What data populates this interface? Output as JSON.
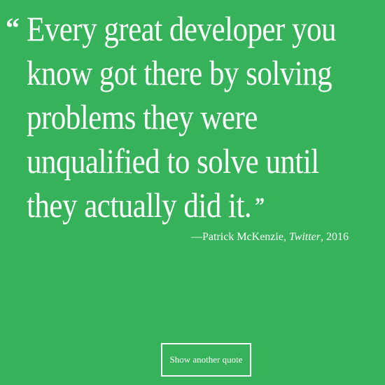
{
  "quote": {
    "open_mark": "“",
    "close_mark": "”",
    "lines": [
      "Every great developer you",
      "know got there by solving",
      "problems they were",
      "unqualified to solve until",
      "they actually did it."
    ]
  },
  "attribution": {
    "prefix": "—Patrick McKenzie,",
    "source": "Twitter",
    "year": ", 2016"
  },
  "button": {
    "label": "Show another quote"
  },
  "colors": {
    "background": "#36b25a",
    "text": "#ffffff"
  }
}
